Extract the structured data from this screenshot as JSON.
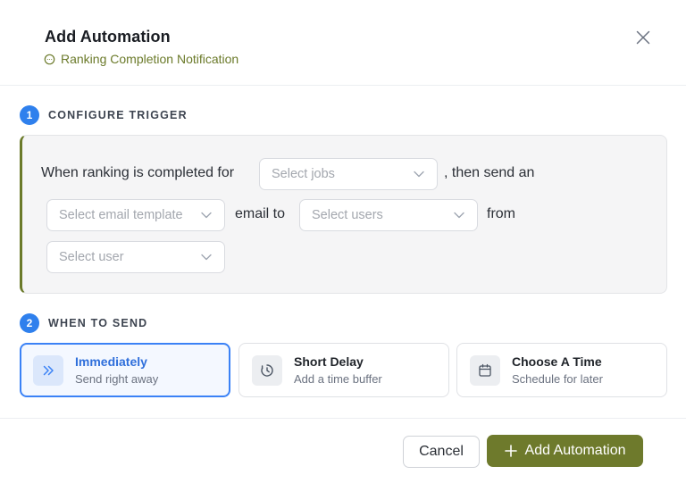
{
  "header": {
    "title": "Add Automation",
    "subtitle": "Ranking Completion Notification",
    "subtitle_icon": "chat-bubble-icon",
    "close_icon": "close-icon"
  },
  "trigger": {
    "step": "1",
    "heading": "CONFIGURE TRIGGER",
    "text_when": "When ranking is completed for",
    "jobs_placeholder": "Select jobs",
    "text_then": ", then send an",
    "template_placeholder": "Select email template",
    "text_email_to": "email to",
    "users_placeholder": "Select users",
    "text_from": "from",
    "user_placeholder": "Select user"
  },
  "when": {
    "step": "2",
    "heading": "WHEN TO SEND",
    "options": [
      {
        "title": "Immediately",
        "desc": "Send right away",
        "icon": "double-chevron-right-icon",
        "selected": true
      },
      {
        "title": "Short Delay",
        "desc": "Add a time buffer",
        "icon": "clock-icon",
        "selected": false
      },
      {
        "title": "Choose A Time",
        "desc": "Schedule for later",
        "icon": "calendar-icon",
        "selected": false
      }
    ]
  },
  "footer": {
    "cancel_label": "Cancel",
    "add_label": "Add Automation"
  },
  "colors": {
    "accent_olive": "#6e7a2c",
    "step_blue": "#2f80ed",
    "selected_blue": "#3b82f6"
  }
}
